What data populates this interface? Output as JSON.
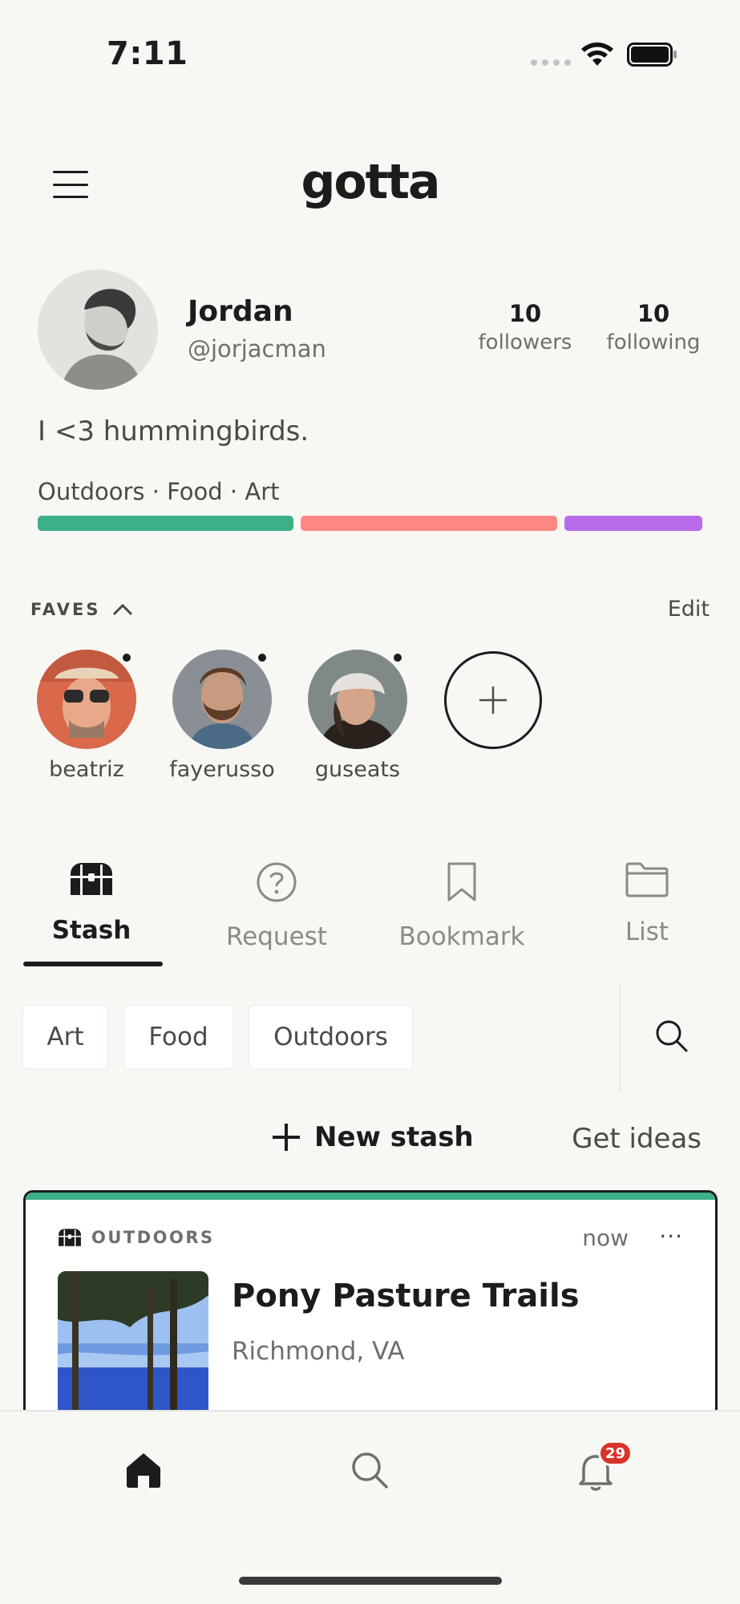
{
  "status_bar": {
    "time": "7:11"
  },
  "header": {
    "logo": "gotta",
    "menu_icon": "hamburger-menu-icon"
  },
  "profile": {
    "name": "Jordan",
    "handle": "@jorjacman",
    "followers_count": "10",
    "followers_label": "followers",
    "following_count": "10",
    "following_label": "following",
    "bio": "I <3 hummingbirds.",
    "interests_text": "Outdoors · Food · Art",
    "interest_colors": [
      "#3db088",
      "#ff8783",
      "#b96cea"
    ]
  },
  "faves": {
    "label": "FAVES",
    "edit_label": "Edit",
    "people": [
      {
        "name": "beatriz"
      },
      {
        "name": "fayerusso"
      },
      {
        "name": "guseats"
      }
    ]
  },
  "tabs": [
    {
      "label": "Stash",
      "icon": "treasure-chest-icon",
      "active": true
    },
    {
      "label": "Request",
      "icon": "question-circle-icon",
      "active": false
    },
    {
      "label": "Bookmark",
      "icon": "bookmark-icon",
      "active": false
    },
    {
      "label": "List",
      "icon": "folder-icon",
      "active": false
    }
  ],
  "filters": [
    "Art",
    "Food",
    "Outdoors"
  ],
  "actions": {
    "new_stash": "New stash",
    "get_ideas": "Get ideas"
  },
  "card": {
    "category": "OUTDOORS",
    "time": "now",
    "more": "···",
    "title": "Pony Pasture Trails",
    "location": "Richmond, VA",
    "accent_color": "#3db088"
  },
  "bottom_nav": {
    "items": [
      "home-icon",
      "search-icon",
      "bell-icon"
    ],
    "notification_count": "29"
  }
}
